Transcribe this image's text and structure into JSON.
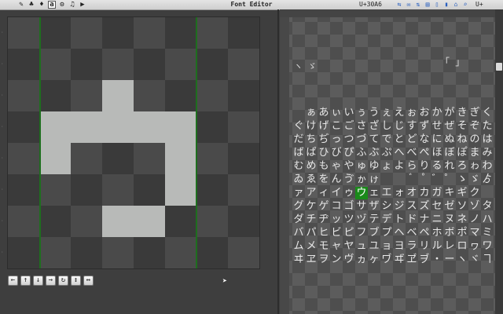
{
  "toolbar": {
    "tools": [
      {
        "name": "pencil-tool",
        "icon": "✎"
      },
      {
        "name": "paint-tool",
        "icon": "♣"
      },
      {
        "name": "fill-tool",
        "icon": "♦"
      },
      {
        "name": "text-tool",
        "icon": "a"
      },
      {
        "name": "settings-tool",
        "icon": "⚙"
      },
      {
        "name": "music-tool",
        "icon": "♫"
      },
      {
        "name": "play-tool",
        "icon": "▶"
      }
    ],
    "right_tools": [
      "⇆",
      "✉",
      "⇅",
      "▤",
      "▯",
      "▮",
      "⌂",
      "⌕"
    ],
    "title": "Font Editor",
    "codepoint": "U+30A6",
    "extra": "U+"
  },
  "nav_buttons": [
    {
      "name": "shift-left-button",
      "icon": "←"
    },
    {
      "name": "shift-up-button",
      "icon": "↑"
    },
    {
      "name": "shift-down-button",
      "icon": "↓"
    },
    {
      "name": "shift-right-button",
      "icon": "→"
    },
    {
      "name": "rotate-button",
      "icon": "↻"
    },
    {
      "name": "flip-vertical-button",
      "icon": "↕"
    },
    {
      "name": "flip-horizontal-button",
      "icon": "↔"
    }
  ],
  "glyph_panel": {
    "marks": "ヽ ゞ",
    "brackets": "「 」",
    "rows": [
      "　ぁあぃいぅうぇえぉおかがきぎく",
      "ぐけげこごさざしじすずせぜそぞた",
      "だちぢっつづてでとどなにぬねのは",
      "ばぱひびぴふぶぷへべぺほぼぽまみ",
      "むめもゃやゅゆょよらりるれろゎわ",
      "ゐゑをんゔゕゖ　　゙゚゛゜ゝゞゟ゠",
      "ァアィイゥウェエォオカガキギク",
      "グケゲコゴサザシジスズセゼソゾタ",
      "ダチヂッツヅテデトドナニヌネノハ",
      "バパヒビピフブプヘベペホボポマミ",
      "ムメモャヤュユョヨラリルレロヮワ",
      "ヰヱヲンヴヵヶヷヸヹヺ・ーヽヾヿ"
    ],
    "selected": "ウ"
  }
}
